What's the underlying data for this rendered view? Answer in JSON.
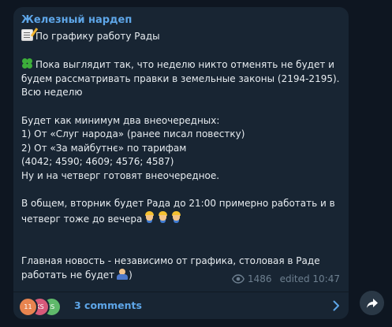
{
  "channel": {
    "name": "Железный нардеп"
  },
  "message": {
    "line_title": "По графику работу Рады",
    "line_p1_a": "Пока выглядит так, что неделю никто отменять не будет и",
    "line_p1_b": "будем рассматривать правки в земельные законы  (2194-2195).",
    "line_p1_c": "Всю неделю",
    "line_p2_a": "Будет как минимум два внеочередных:",
    "line_p2_b": "1) От «Слуг народа» (ранее писал повестку)",
    "line_p2_c": "2) От «За майбутнє» по тарифам",
    "line_p2_d": "(4042; 4590; 4609; 4576; 4587)",
    "line_p2_e": "Ну и на четверг готовят внеочередное.",
    "line_p3_a": "В общем, вторник будет Рада до 21:00 примерно работать и в",
    "line_p3_b": "четверг тоже до вечера",
    "line_p4_a": "Главная новость - независимо от графика, столовая в Раде",
    "line_p4_b": "работать не будет",
    "line_p4_b_tail": ")"
  },
  "meta": {
    "views": "1486",
    "edited": "edited 10:47"
  },
  "comments": {
    "label": "3 comments",
    "avatars": [
      {
        "initials": "11",
        "color": "#e8844f"
      },
      {
        "initials": "KS",
        "color": "#d85a7a"
      },
      {
        "initials": "IS",
        "color": "#5fb96a"
      }
    ]
  },
  "icons": {
    "memo": "memo-icon",
    "clover": "four-leaf-clover-icon",
    "worker": "construction-worker-icon",
    "shrug": "person-shrugging-icon",
    "eye": "eye-icon",
    "chevron": "chevron-right-icon",
    "share": "share-arrow-icon"
  },
  "colors": {
    "background": "#0e1621",
    "bubble": "#182533",
    "accent": "#5ea6e8",
    "text": "#e7ecf0",
    "meta": "#6d7f8f"
  }
}
